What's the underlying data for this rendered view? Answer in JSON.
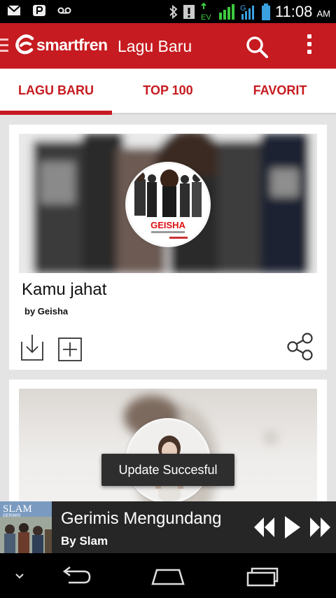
{
  "status_bar": {
    "time": "11:08",
    "ampm": "AM",
    "network_label": "EV",
    "signal_label": "G",
    "icons": [
      "gmail-icon",
      "pocket-icon",
      "voicemail-icon",
      "bluetooth-icon",
      "alert-icon",
      "data-arrows-icon",
      "signal-icon",
      "battery-icon"
    ]
  },
  "app_bar": {
    "logo_text": "smartfren",
    "title": "Lagu Baru",
    "brand_color": "#c61b20"
  },
  "tabs": [
    {
      "label": "LAGU BARU",
      "selected": true
    },
    {
      "label": "TOP 100",
      "selected": false
    },
    {
      "label": "FAVORIT",
      "selected": false
    }
  ],
  "songs": [
    {
      "title": "Kamu jahat",
      "artist": "by Geisha",
      "cover_text": "GEISHA"
    },
    {
      "title": "",
      "artist": ""
    }
  ],
  "toast": {
    "message": "Update Succesful"
  },
  "player": {
    "title": "Gerimis Mengundang",
    "artist": "By Slam",
    "art_text": "SLAM",
    "art_subtext": "GERIMIS"
  }
}
